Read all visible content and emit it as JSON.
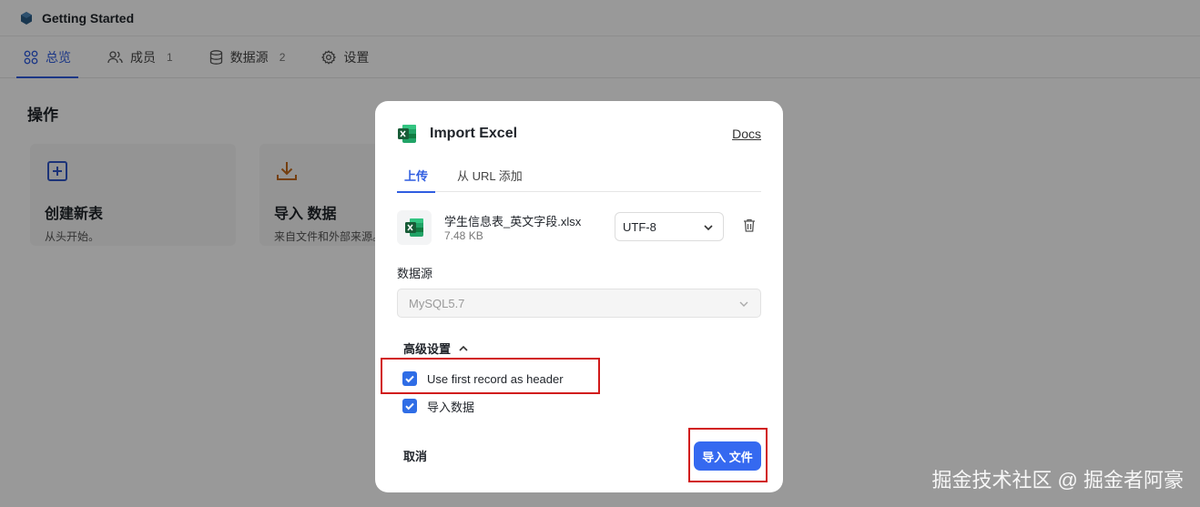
{
  "app": {
    "title": "Getting Started",
    "tabs": [
      {
        "label": "总览",
        "count": ""
      },
      {
        "label": "成员",
        "count": "1"
      },
      {
        "label": "数据源",
        "count": "2"
      },
      {
        "label": "设置",
        "count": ""
      }
    ],
    "section_title": "操作",
    "cards": [
      {
        "title": "创建新表",
        "desc": "从头开始。"
      },
      {
        "title": "导入 数据",
        "desc": "来自文件和外部来源。"
      }
    ]
  },
  "modal": {
    "title": "Import Excel",
    "docs_link": "Docs",
    "tabs": [
      "上传",
      "从 URL 添加"
    ],
    "file": {
      "name": "学生信息表_英文字段.xlsx",
      "size": "7.48 KB",
      "encoding": "UTF-8"
    },
    "datasource": {
      "label": "数据源",
      "value": "MySQL5.7"
    },
    "advanced_label": "高级设置",
    "options": [
      {
        "label": "Use first record as header",
        "checked": true
      },
      {
        "label": "导入数据",
        "checked": true
      }
    ],
    "cancel_label": "取消",
    "import_label": "导入 文件"
  },
  "watermark": "掘金技术社区 @ 掘金者阿豪",
  "colors": {
    "accent": "#2f5de0",
    "button": "#3569f0",
    "highlight_box": "#d11a1a",
    "excel_green": "#1e7a45"
  }
}
